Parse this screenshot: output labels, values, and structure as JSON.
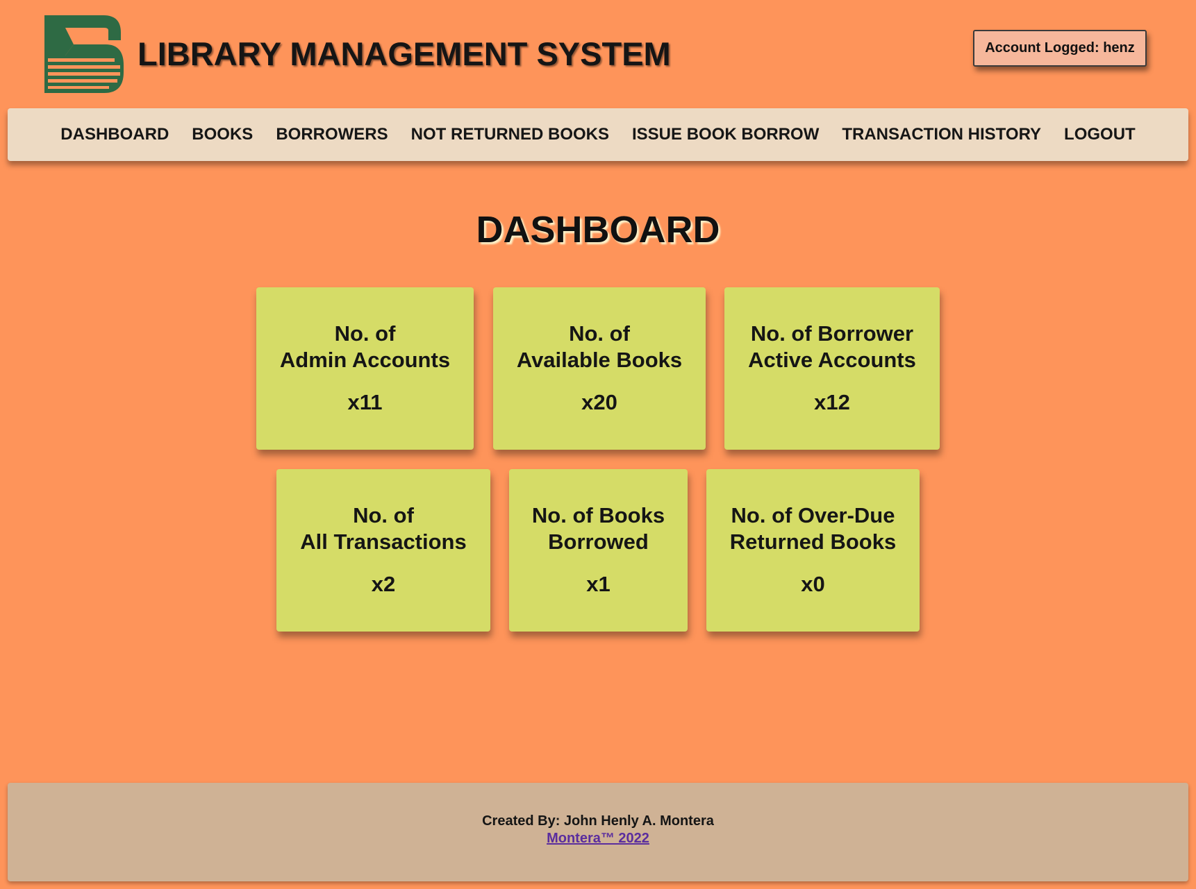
{
  "header": {
    "app_title": "LIBRARY MANAGEMENT SYSTEM",
    "account_label": "Account Logged: henz",
    "logo_icon": "book-stack-logo-icon",
    "logo_color": "#2e6a44"
  },
  "nav": {
    "items": [
      {
        "label": "DASHBOARD"
      },
      {
        "label": "BOOKS"
      },
      {
        "label": "BORROWERS"
      },
      {
        "label": "NOT RETURNED BOOKS"
      },
      {
        "label": "ISSUE BOOK BORROW"
      },
      {
        "label": "TRANSACTION HISTORY"
      },
      {
        "label": "LOGOUT"
      }
    ]
  },
  "main": {
    "page_title": "DASHBOARD",
    "cards": [
      {
        "label": "No. of\nAdmin Accounts",
        "value": "x11"
      },
      {
        "label": "No. of\nAvailable Books",
        "value": "x20"
      },
      {
        "label": "No. of Borrower\nActive Accounts",
        "value": "x12"
      },
      {
        "label": "No. of\nAll Transactions",
        "value": "x2"
      },
      {
        "label": "No. of Books\nBorrowed",
        "value": "x1"
      },
      {
        "label": "No. of Over-Due\nReturned Books",
        "value": "x0"
      }
    ]
  },
  "footer": {
    "credit": "Created By: John Henly A. Montera",
    "link_text": "Montera™ 2022"
  },
  "colors": {
    "background": "#fe945a",
    "navbar": "#eddac3",
    "card": "#d5dc67",
    "footer": "#cfb295",
    "account_badge": "#f6b79b",
    "link": "#5a2d9e"
  }
}
